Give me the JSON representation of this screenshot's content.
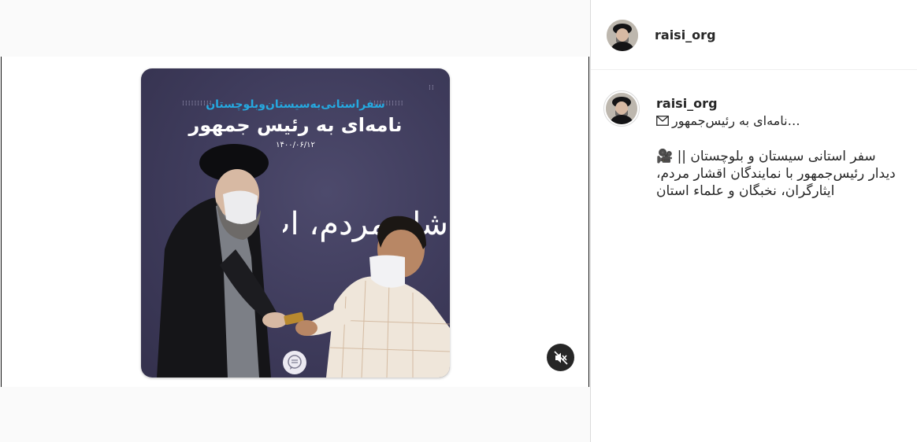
{
  "post": {
    "username": "raisi_org",
    "image": {
      "subtitle": "سفراستانی‌به‌سیستان‌وبلوچستان",
      "title": "نامه‌ای به رئیس جمهور",
      "date": "۱۴۰۰/۰۶/۱۲",
      "background_writing": "شار مردم، اب"
    },
    "mute_icon": "speaker-muted-icon"
  },
  "caption": {
    "username": "raisi_org",
    "heading_icon": "envelope-icon",
    "heading_text": "نامه‌ای به رئیس‌جمهور…",
    "lines": [
      "سفر استانی سیستان و بلوچستان || 🎥",
      "دیدار رئیس‌جمهور با نمایندگان اقشار مردم،",
      "ایثارگران، نخبگان و علماء استان"
    ]
  },
  "colors": {
    "image_bg": "#3e3b5b",
    "accent_blue": "#25a9e0",
    "text_primary": "#262626",
    "divider": "#dbdbdb"
  }
}
